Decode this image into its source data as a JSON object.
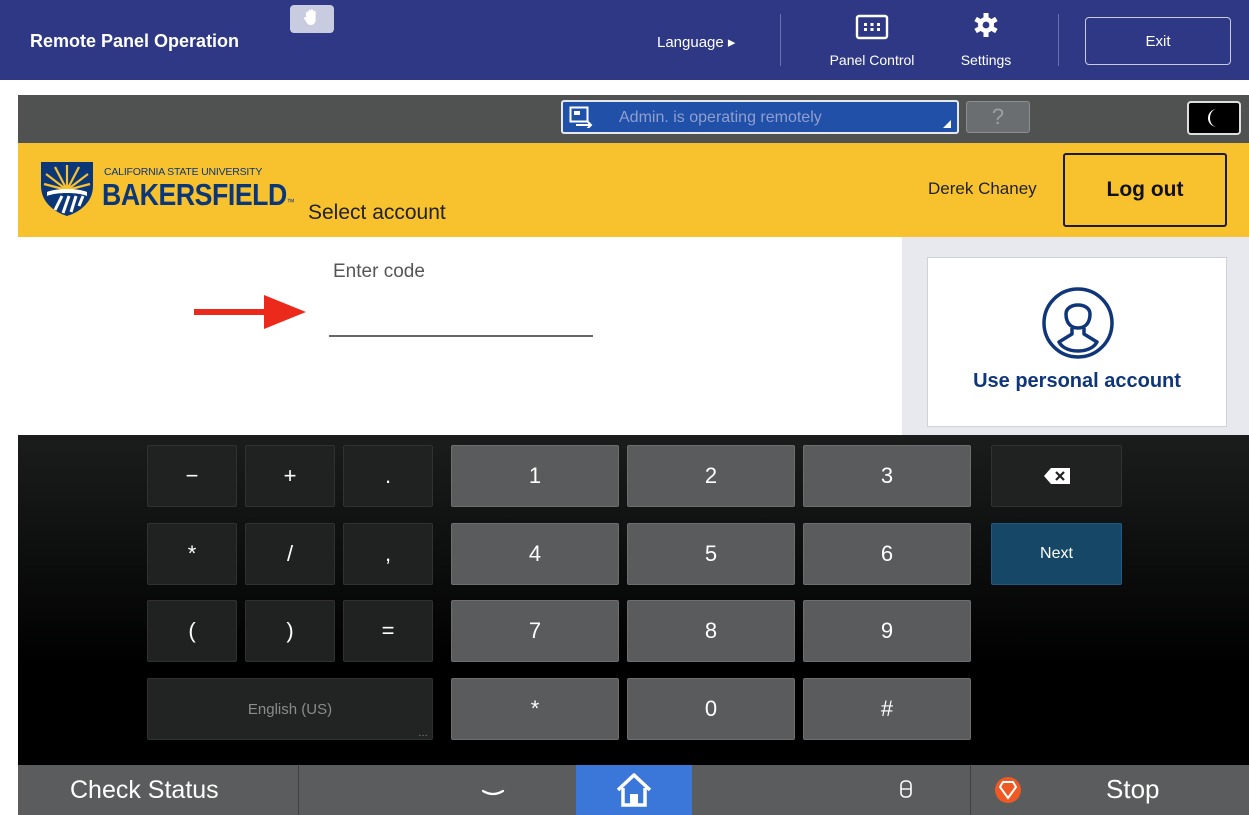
{
  "topbar": {
    "title": "Remote Panel Operation",
    "language_label": "Language ▸",
    "panel_control_label": "Panel Control",
    "settings_label": "Settings",
    "exit_label": "Exit",
    "bg_color": "#2e3884"
  },
  "status": {
    "remote_message": "Admin. is operating remotely",
    "help_label": "?"
  },
  "header": {
    "logo_top": "CALIFORNIA STATE UNIVERSITY",
    "logo_main": "BAKERSFIELD",
    "logo_tm": "™",
    "page_title": "Select account",
    "user_name": "Derek Chaney",
    "logout_label": "Log out",
    "accent_color": "#f8c22f"
  },
  "entry": {
    "code_label": "Enter code",
    "code_value": ""
  },
  "side": {
    "personal_account_label": "Use personal account"
  },
  "keypad": {
    "symbols": [
      "−",
      "+",
      ".",
      "*",
      "/",
      ",",
      "(",
      ")",
      "="
    ],
    "digits": [
      "1",
      "2",
      "3",
      "4",
      "5",
      "6",
      "7",
      "8",
      "9",
      "*",
      "0",
      "#"
    ],
    "language_label": "English (US)",
    "next_label": "Next"
  },
  "bottom": {
    "check_status_label": "Check Status",
    "stop_label": "Stop"
  }
}
